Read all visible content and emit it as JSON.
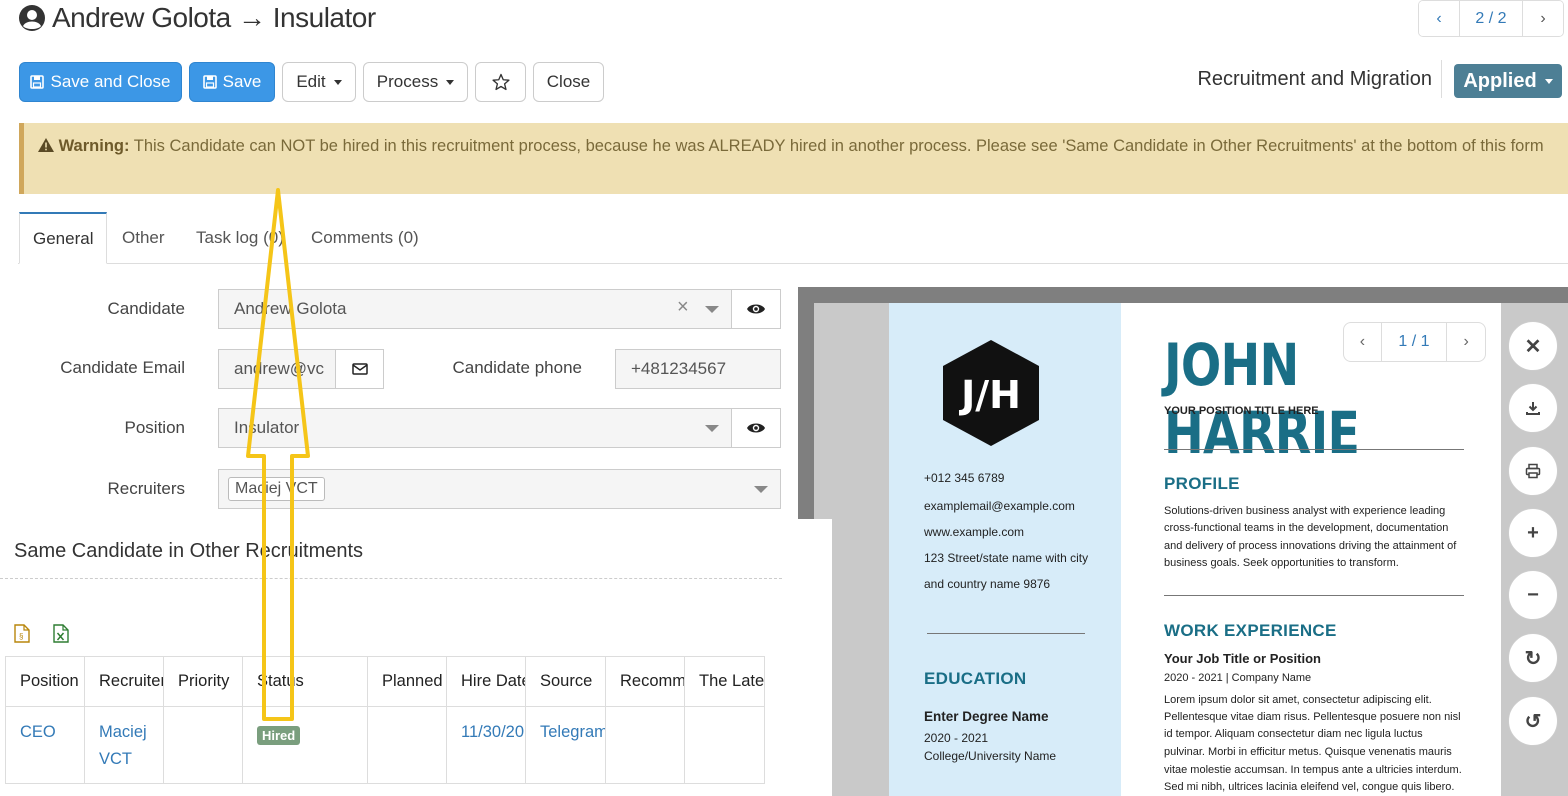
{
  "header": {
    "title": "Andrew Golota → Insulator",
    "pager": "2 / 2"
  },
  "toolbar": {
    "save_close": "Save and Close",
    "save": "Save",
    "edit": "Edit",
    "process": "Process",
    "close": "Close",
    "module": "Recruitment and Migration",
    "status": "Applied"
  },
  "warning": {
    "label": "Warning:",
    "text": "This Candidate can NOT be hired in this recruitment process, because he was ALREADY hired in another process. Please see 'Same Candidate in Other Recruitments' at the bottom of this form"
  },
  "tabs": [
    "General",
    "Other",
    "Task log (0)",
    "Comments (0)"
  ],
  "form": {
    "candidate_label": "Candidate",
    "candidate_value": "Andrew Golota",
    "email_label": "Candidate Email",
    "email_value": "andrew@vc",
    "phone_label": "Candidate phone",
    "phone_value": "+481234567",
    "position_label": "Position",
    "position_value": "Insulator",
    "recruiters_label": "Recruiters",
    "recruiters_value": "Maciej VCT"
  },
  "section": {
    "title": "Same Candidate in Other Recruitments"
  },
  "table": {
    "headers": [
      "Position",
      "Recruiter",
      "Priority",
      "Status",
      "Planned",
      "Hire Date",
      "Source",
      "Recomm",
      "The Lates"
    ],
    "row": {
      "position": "CEO",
      "recruiter_line1": "Maciej",
      "recruiter_line2": "VCT",
      "status": "Hired",
      "hire_date": "11/30/20",
      "source": "Telegram"
    }
  },
  "viewer": {
    "pager": "1 / 1",
    "resume": {
      "logo": "J/H",
      "name": "JOHN HARRIE",
      "position": "YOUR POSITION TITLE HERE",
      "phone": "+012 345 6789",
      "email": "examplemail@example.com",
      "web": "www.example.com",
      "address1": "123 Street/state name with city",
      "address2": "and country name 9876",
      "education": "EDUCATION",
      "degree": "Enter  Degree Name",
      "edu_years": "2020 - 2021",
      "college": "College/University Name",
      "profile": "PROFILE",
      "profile_l1": "Solutions-driven business analyst with experience leading",
      "profile_l2": "cross-functional teams in the development, documentation",
      "profile_l3": "and delivery of process innovations driving the attainment of",
      "profile_l4": "business goals. Seek opportunities to transform.",
      "work": "WORK EXPERIENCE",
      "job_title": "Your Job Title or Position",
      "job_years": "2020 - 2021 | Company Name",
      "work_l1": "Lorem ipsum dolor sit amet, consectetur adipiscing elit.",
      "work_l2": "Pellentesque vitae diam risus. Pellentesque posuere non nisl",
      "work_l3": "id tempor. Aliquam consectetur diam nec ligula luctus",
      "work_l4": "pulvinar. Morbi in efficitur metus. Quisque venenatis mauris",
      "work_l5": "vitae molestie accumsan. In tempus ante a ultricies interdum.",
      "work_l6": "Sed mi nibh, ultrices lacinia eleifend vel, congue quis libero."
    }
  },
  "colors": {
    "primary": "#3c97e6",
    "status": "#4d7f95",
    "warning_bg": "#efe0b3",
    "arrow": "#f5c518",
    "resume_accent": "#1a6e86"
  }
}
